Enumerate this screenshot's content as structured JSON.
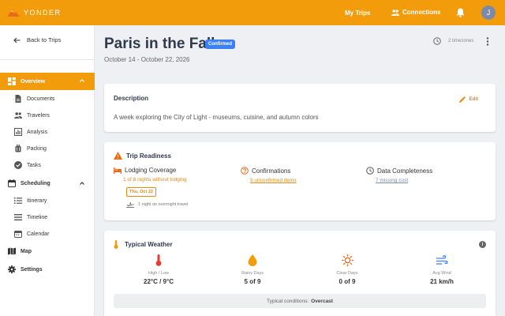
{
  "app": {
    "brand": "YONDER",
    "brand_color": "#f39c0b"
  },
  "topnav": {
    "my_trips": "My Trips",
    "connections": "Connections",
    "avatar_initial": "J"
  },
  "sidebar": {
    "back": "Back to Trips",
    "overview": "Overview",
    "overview_items": [
      "Documents",
      "Travelers",
      "Analysis",
      "Packing",
      "Tasks"
    ],
    "scheduling": "Scheduling",
    "scheduling_items": [
      "Itinerary",
      "Timeline",
      "Calendar"
    ],
    "map": "Map",
    "settings": "Settings"
  },
  "trip": {
    "title": "Paris in the Fall",
    "status": "Confirmed",
    "dates": "October 14 - October 22, 2026",
    "timezones": "2 timezones"
  },
  "description": {
    "heading": "Description",
    "edit": "Edit",
    "text": "A week exploring the City of Light - museums, cuisine, and autumn colors"
  },
  "readiness": {
    "heading": "Trip Readiness",
    "lodging_title": "Lodging Coverage",
    "lodging_detail": "1 of 8 nights without lodging",
    "lodging_date": "Thu, Oct 22",
    "overnight_note": "1 night on overnight travel",
    "confirmations_title": "Confirmations",
    "confirmations_detail": "9 unconfirmed items",
    "completeness_title": "Data Completeness",
    "completeness_detail": "7 missing cost"
  },
  "weather": {
    "heading": "Typical Weather",
    "stats": [
      {
        "label": "High / Low",
        "value": "22°C / 9°C"
      },
      {
        "label": "Rainy Days",
        "value": "5 of 9"
      },
      {
        "label": "Clear Days",
        "value": "0 of 9"
      },
      {
        "label": "Avg Wind",
        "value": "21 km/h"
      }
    ],
    "conditions_label": "Typical conditions:",
    "conditions_value": "Overcast"
  }
}
